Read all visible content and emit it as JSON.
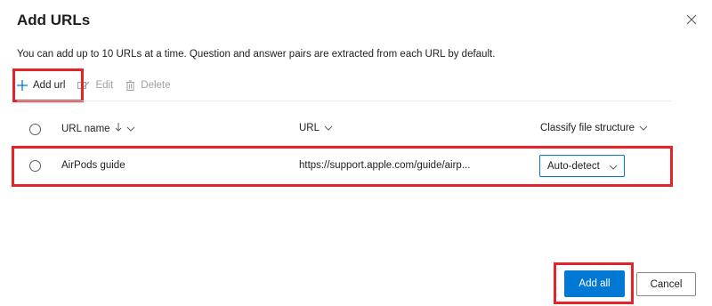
{
  "dialog": {
    "title": "Add URLs",
    "description": "You can add up to 10 URLs at a time. Question and answer pairs are extracted from each URL by default."
  },
  "toolbar": {
    "add_label": "Add url",
    "edit_label": "Edit",
    "delete_label": "Delete"
  },
  "table": {
    "columns": {
      "url_name": "URL name",
      "url": "URL",
      "classify": "Classify file structure"
    },
    "rows": [
      {
        "url_name": "AirPods guide",
        "url": "https://support.apple.com/guide/airp...",
        "classify": "Auto-detect"
      }
    ]
  },
  "footer": {
    "primary_label": "Add all",
    "secondary_label": "Cancel"
  },
  "colors": {
    "accent": "#0078d4",
    "highlight": "#e3242b"
  }
}
